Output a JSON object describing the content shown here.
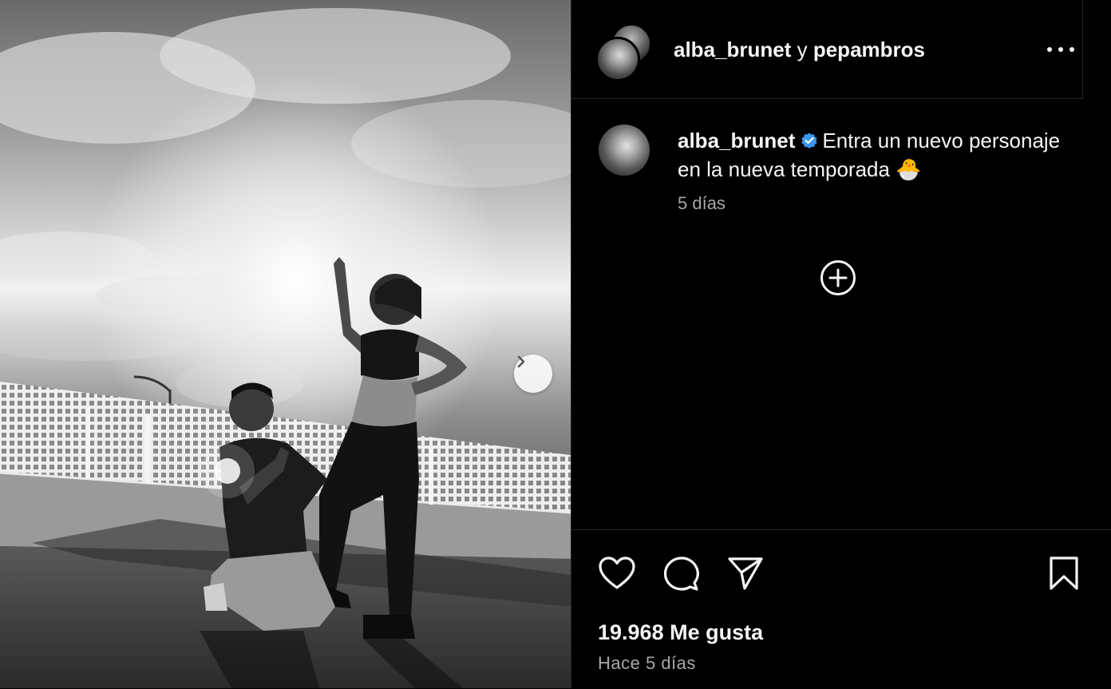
{
  "post": {
    "media_alt": "Black and white rooftop photo of a couple under a cloudy sky",
    "carousel_next_icon": "chevron-right-icon"
  },
  "header": {
    "user1": "alba_brunet",
    "conjunction": "y",
    "user2": "pepambros",
    "more_icon": "more-dots-icon"
  },
  "caption": {
    "username": "alba_brunet",
    "verified_icon": "verified-badge-icon",
    "text": "Entra un nuevo personaje en la nueva temporada 🐣",
    "time": "5 días"
  },
  "comments": {
    "load_more_icon": "plus-circle-icon"
  },
  "actions": {
    "like_icon": "heart-icon",
    "comment_icon": "comment-icon",
    "share_icon": "send-icon",
    "save_icon": "bookmark-icon"
  },
  "stats": {
    "likes_count": "19.968",
    "likes_label": "Me gusta",
    "posted": "Hace 5 días"
  },
  "colors": {
    "background": "#000000",
    "text": "#f5f5f5",
    "muted": "#a8a8a8",
    "verified": "#3897f0",
    "divider": "#262626"
  }
}
